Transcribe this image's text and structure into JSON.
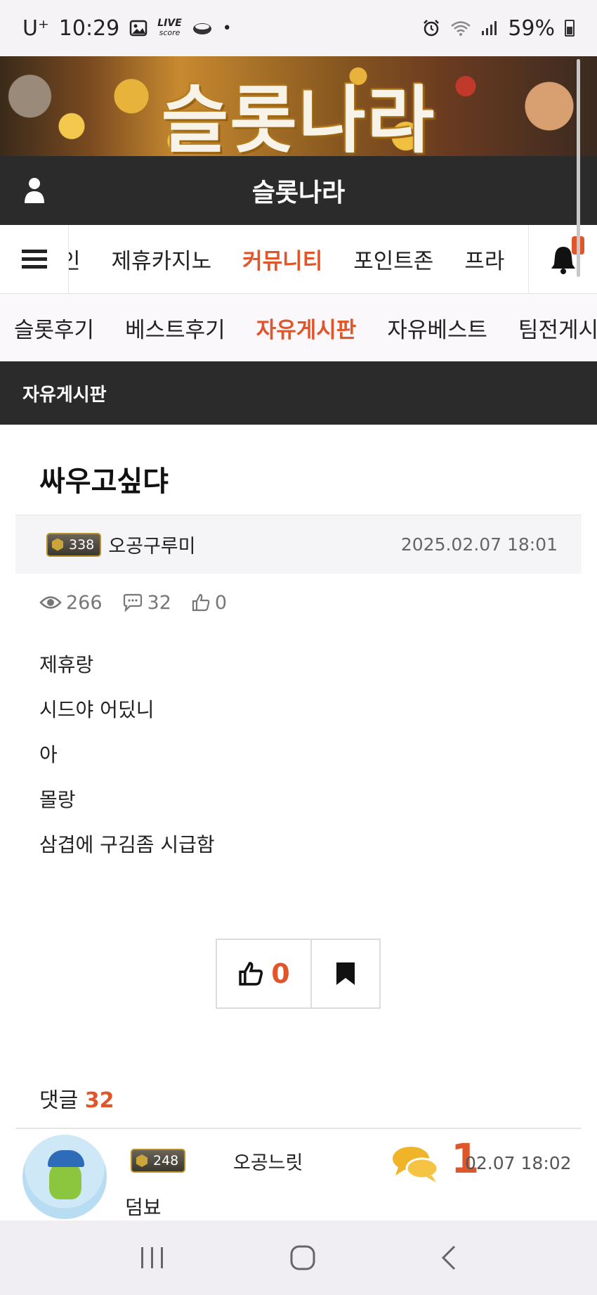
{
  "status_bar": {
    "carrier": "U⁺",
    "time": "10:29",
    "live_badge_top": "LIVE",
    "live_badge_bottom": "score",
    "dot": "•",
    "battery": "59%"
  },
  "banner": {
    "logo_text": "슬롯나라"
  },
  "header": {
    "site_title": "슬롯나라"
  },
  "main_nav": {
    "items": [
      {
        "label": "인",
        "active": false
      },
      {
        "label": "제휴카지노",
        "active": false
      },
      {
        "label": "커뮤니티",
        "active": true
      },
      {
        "label": "포인트존",
        "active": false
      },
      {
        "label": "프라",
        "active": false
      }
    ]
  },
  "sub_nav": {
    "items": [
      {
        "label": "슬롯후기",
        "active": false
      },
      {
        "label": "베스트후기",
        "active": false
      },
      {
        "label": "자유게시판",
        "active": true
      },
      {
        "label": "자유베스트",
        "active": false
      },
      {
        "label": "팀전게시",
        "active": false
      }
    ]
  },
  "board": {
    "name": "자유게시판"
  },
  "post": {
    "title": "싸우고싶댜",
    "author": {
      "level": "338",
      "name": "오공구루미"
    },
    "date": "2025.02.07 18:01",
    "views": "266",
    "comments": "32",
    "likes": "0",
    "body": [
      "제휴랑",
      "시드야 어딨니",
      "아",
      "몰랑",
      "삼겹에 구김좀 시급함"
    ],
    "like_button_count": "0"
  },
  "comments": {
    "label": "댓글",
    "count": "32",
    "items": [
      {
        "level": "248",
        "name": "오공느릿",
        "reply_count": "1",
        "date": "02.07 18:02",
        "text": "덤뵤"
      }
    ]
  },
  "colors": {
    "accent": "#e0562b",
    "dark_bar": "#2b2b2b"
  }
}
